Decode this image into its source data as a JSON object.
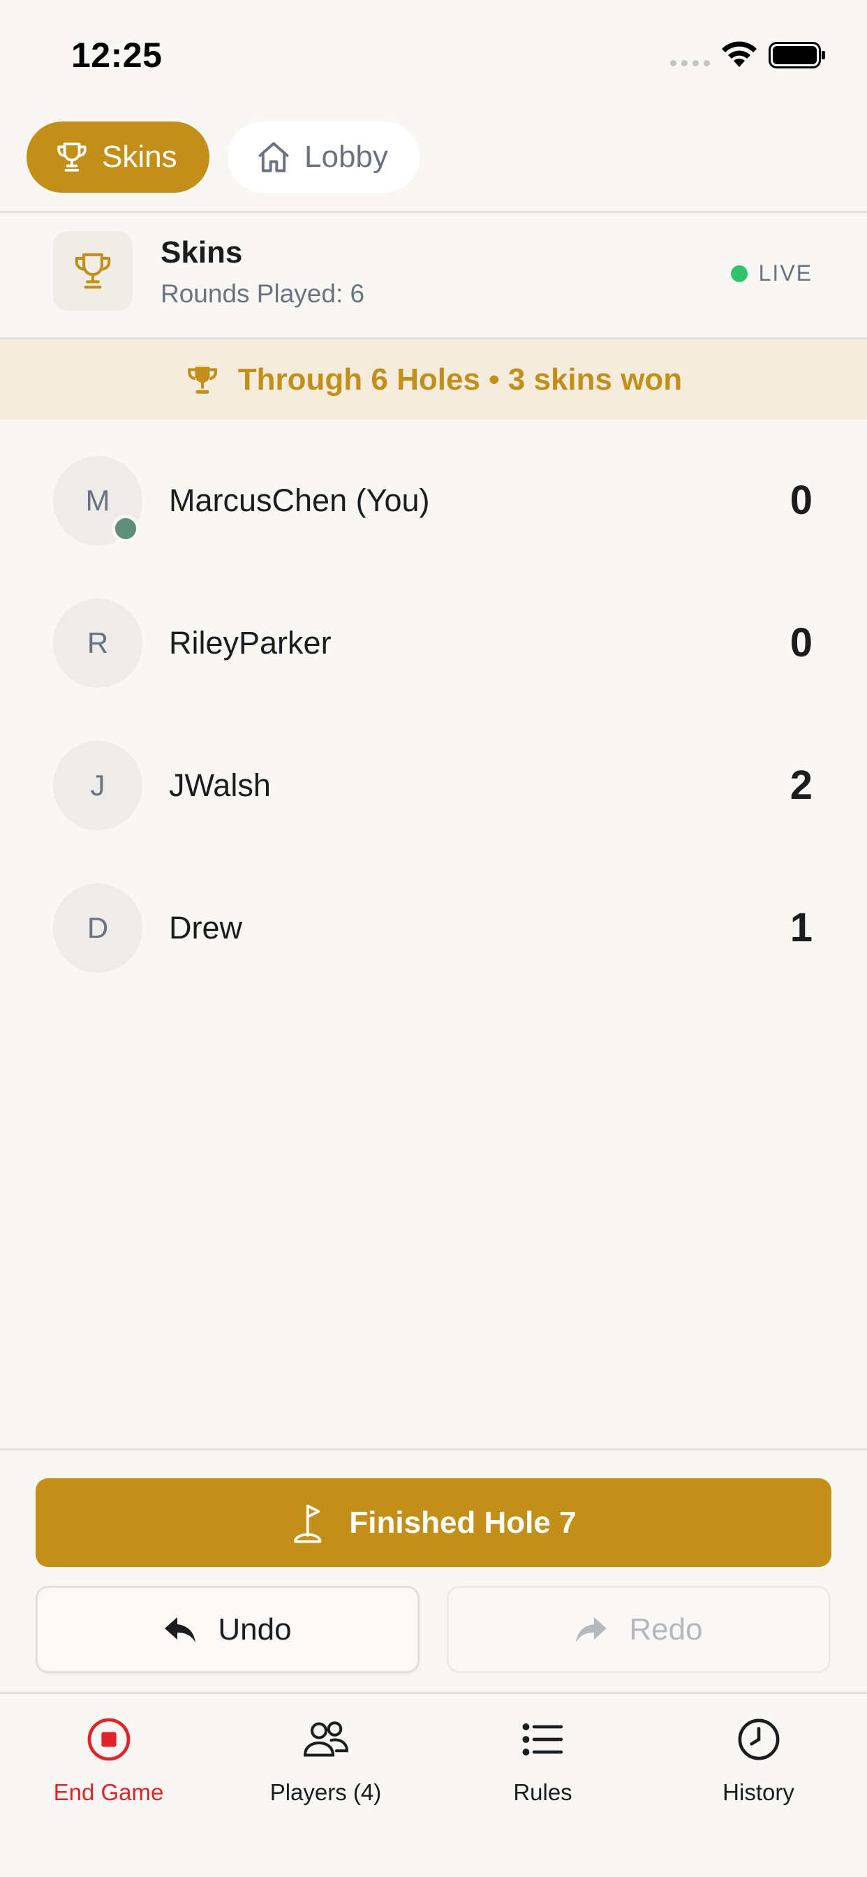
{
  "status_bar": {
    "time": "12:25"
  },
  "top_tabs": {
    "skins_label": "Skins",
    "lobby_label": "Lobby"
  },
  "game": {
    "title": "Skins",
    "subtitle": "Rounds Played: 6",
    "live_label": "LIVE"
  },
  "banner": {
    "text": "Through 6 Holes • 3 skins won"
  },
  "players": [
    {
      "initial": "M",
      "name": "MarcusChen (You)",
      "score": "0",
      "online": true
    },
    {
      "initial": "R",
      "name": "RileyParker",
      "score": "0",
      "online": false
    },
    {
      "initial": "J",
      "name": "JWalsh",
      "score": "2",
      "online": false
    },
    {
      "initial": "D",
      "name": "Drew",
      "score": "1",
      "online": false
    }
  ],
  "actions": {
    "finish_label": "Finished Hole 7",
    "undo_label": "Undo",
    "redo_label": "Redo"
  },
  "tab_bar": {
    "end_game": "End Game",
    "players": "Players (4)",
    "rules": "Rules",
    "history": "History"
  },
  "colors": {
    "accent_gold": "#c28f18",
    "live_green": "#2fc46a",
    "end_red": "#e0242a",
    "online_green": "#5f8f7a"
  }
}
